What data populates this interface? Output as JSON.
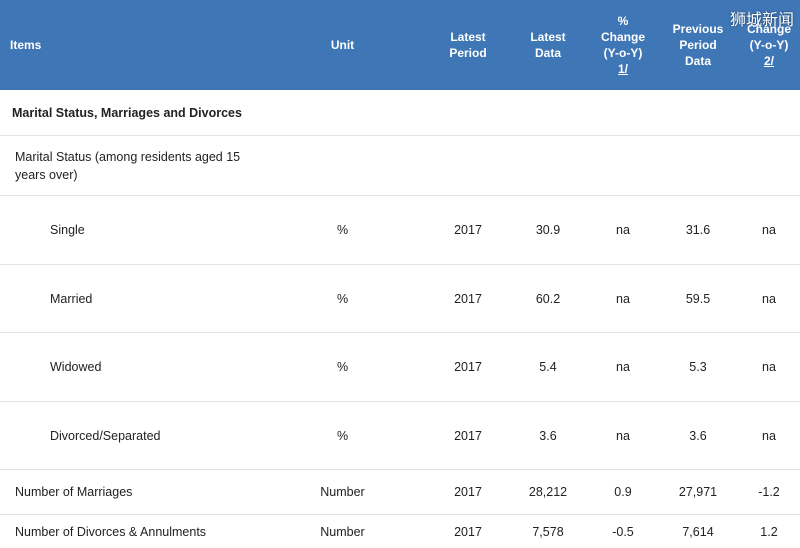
{
  "header": {
    "items": "Items",
    "unit": "Unit",
    "latest_period": [
      "Latest",
      "Period"
    ],
    "latest_data": [
      "Latest",
      "Data"
    ],
    "pct_change": [
      "%",
      "Change",
      "(Y-o-Y)",
      "1/"
    ],
    "previous_data": [
      "Previous",
      "Period",
      "Data"
    ],
    "change": [
      "Change",
      "(Y-o-Y)",
      "2/"
    ],
    "watermark": "狮城新闻"
  },
  "section": {
    "title": "Marital Status, Marriages and Divorces"
  },
  "subsection": {
    "title": "Marital Status (among residents aged 15 years over)"
  },
  "rows": [
    {
      "item": "Single",
      "unit": "%",
      "period": "2017",
      "latest": "30.9",
      "pct": "na",
      "previous": "31.6",
      "change": "na"
    },
    {
      "item": "Married",
      "unit": "%",
      "period": "2017",
      "latest": "60.2",
      "pct": "na",
      "previous": "59.5",
      "change": "na"
    },
    {
      "item": "Widowed",
      "unit": "%",
      "period": "2017",
      "latest": "5.4",
      "pct": "na",
      "previous": "5.3",
      "change": "na"
    },
    {
      "item": "Divorced/Separated",
      "unit": "%",
      "period": "2017",
      "latest": "3.6",
      "pct": "na",
      "previous": "3.6",
      "change": "na"
    },
    {
      "item": "Number of Marriages",
      "unit": "Number",
      "period": "2017",
      "latest": "28,212",
      "pct": "0.9",
      "previous": "27,971",
      "change": "-1.2"
    },
    {
      "item": "Number of Divorces & Annulments",
      "unit": "Number",
      "period": "2017",
      "latest": "7,578",
      "pct": "-0.5",
      "previous": "7,614",
      "change": "1.2"
    }
  ]
}
